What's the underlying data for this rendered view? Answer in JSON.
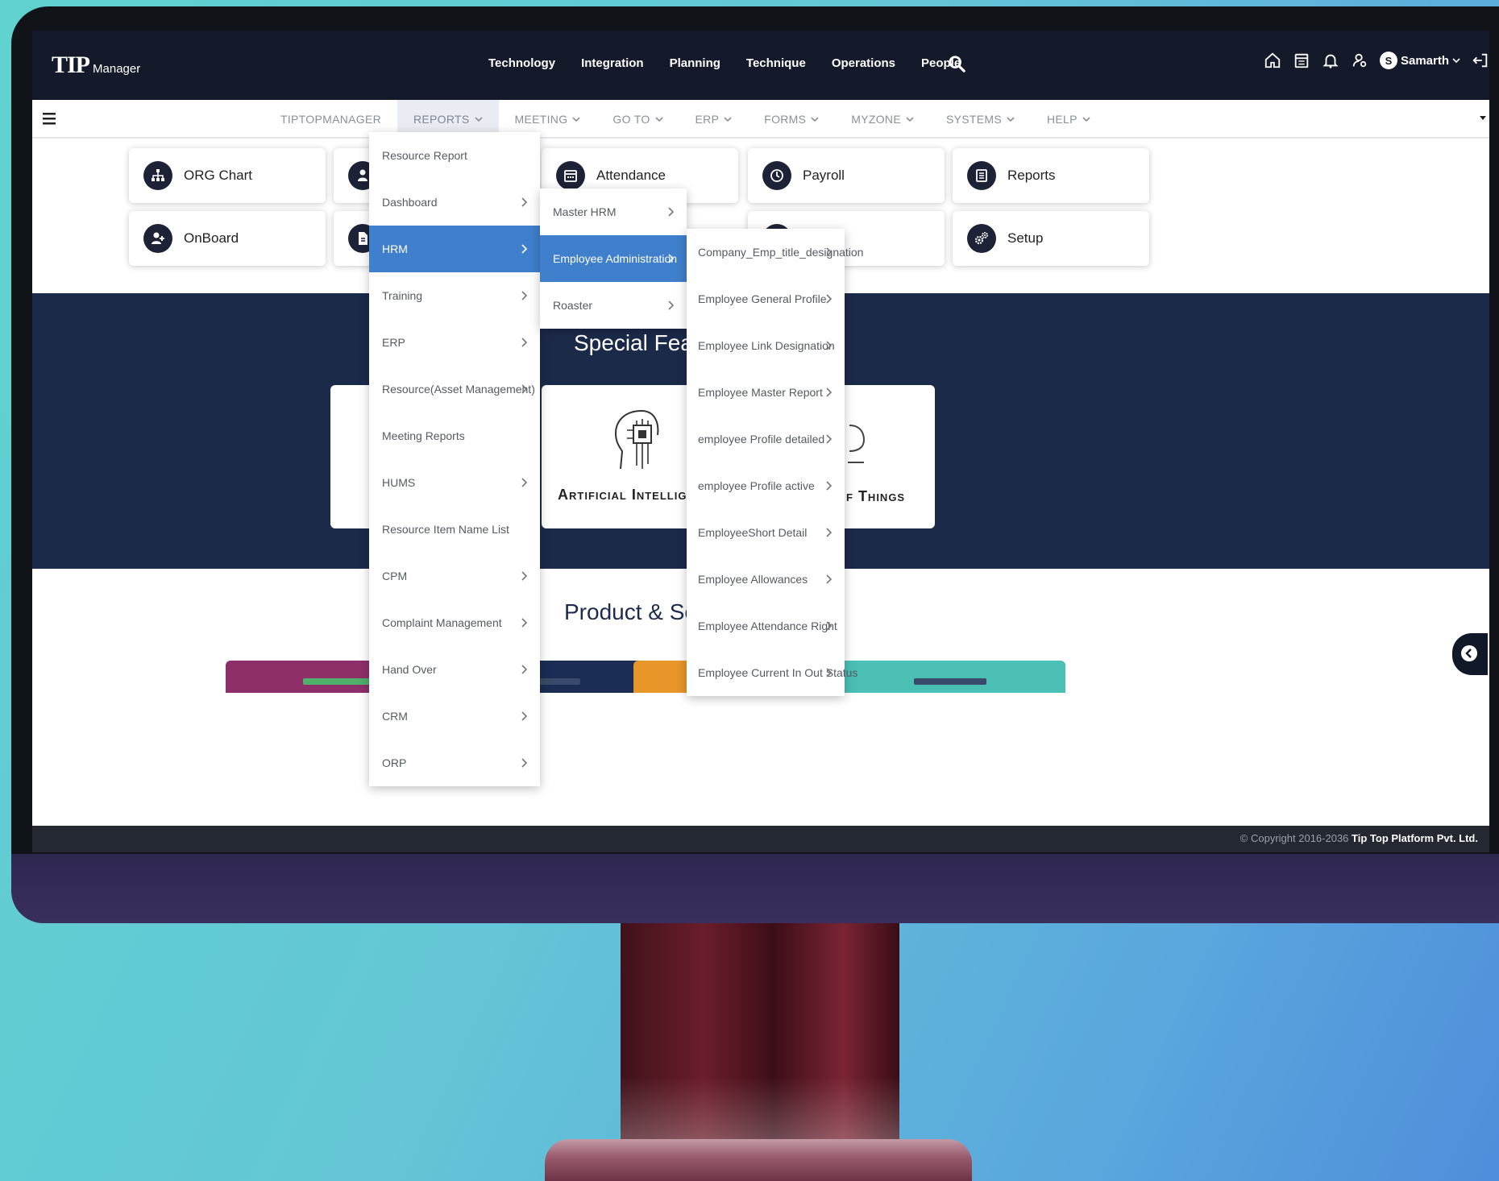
{
  "header": {
    "logo": "TIP",
    "logo_sub": "Manager",
    "nav": [
      "Technology",
      "Integration",
      "Planning",
      "Technique",
      "Operations",
      "People"
    ],
    "user_initial": "S",
    "user_name": "Samarth"
  },
  "menu": {
    "items": [
      {
        "label": "TIPTOPMANAGER",
        "has_dropdown": false
      },
      {
        "label": "REPORTS",
        "has_dropdown": true
      },
      {
        "label": "MEETING",
        "has_dropdown": true
      },
      {
        "label": "GO TO",
        "has_dropdown": true
      },
      {
        "label": "ERP",
        "has_dropdown": true
      },
      {
        "label": "FORMS",
        "has_dropdown": true
      },
      {
        "label": "MYZONE",
        "has_dropdown": true
      },
      {
        "label": "SYSTEMS",
        "has_dropdown": true
      },
      {
        "label": "HELP",
        "has_dropdown": true
      }
    ],
    "active": "REPORTS"
  },
  "cards": {
    "org_chart": "ORG Chart",
    "onboard": "OnBoard",
    "attendance": "Attendance",
    "payroll": "Payroll",
    "reports": "Reports",
    "setup": "Setup"
  },
  "features": {
    "title": "Special Feature",
    "ai_label": "Artificial Intelligen",
    "iot_label": "f Things"
  },
  "products": {
    "title": "Product & Servic",
    "colors": [
      "#8e2f6a",
      "#1b2d55",
      "#e8962a",
      "#4bbfb4"
    ]
  },
  "reports_menu": {
    "items": [
      {
        "label": "Resource Report",
        "sub": false
      },
      {
        "label": "Dashboard",
        "sub": true
      },
      {
        "label": "HRM",
        "sub": true,
        "active": true
      },
      {
        "label": "Training",
        "sub": true
      },
      {
        "label": "ERP",
        "sub": true
      },
      {
        "label": "Resource(Asset Management)",
        "sub": true
      },
      {
        "label": "Meeting Reports",
        "sub": false
      },
      {
        "label": "HUMS",
        "sub": true
      },
      {
        "label": "Resource Item Name List",
        "sub": false
      },
      {
        "label": "CPM",
        "sub": true
      },
      {
        "label": "Complaint Management",
        "sub": true
      },
      {
        "label": "Hand Over",
        "sub": true
      },
      {
        "label": "CRM",
        "sub": true
      },
      {
        "label": "ORP",
        "sub": true
      }
    ]
  },
  "hrm_menu": {
    "items": [
      {
        "label": "Master HRM",
        "sub": true
      },
      {
        "label": "Employee Administration",
        "sub": true,
        "active": true
      },
      {
        "label": "Roaster",
        "sub": true
      }
    ]
  },
  "employee_admin_menu": {
    "items": [
      "Company_Emp_title_designation",
      "Employee General Profile",
      "Employee Link Designation",
      "Employee Master Report",
      "employee Profile detailed",
      "employee Profile active",
      "EmployeeShort Detail",
      "Employee Allowances",
      "Employee Attendance Right",
      "Employee Current In Out Status"
    ]
  },
  "footer": {
    "copyright": "© Copyright 2016-2036",
    "company": "Tip Top Platform Pvt. Ltd."
  }
}
